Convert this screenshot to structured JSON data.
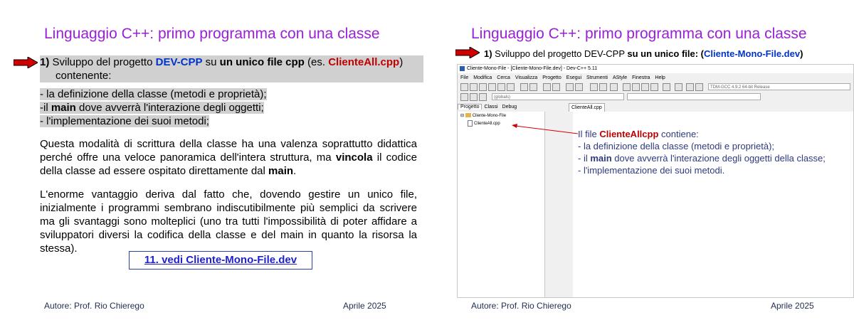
{
  "left": {
    "title": "Linguaggio C++: primo programma con una classe",
    "point1": {
      "num": "1)",
      "pre": " Sviluppo del progetto ",
      "devcpp": "DEV-CPP",
      "mid": " su ",
      "bold": "un unico file cpp",
      "es": "  (es. ",
      "file": "ClienteAll.cpp",
      "close": ")",
      "cont": "contenente:"
    },
    "defs": [
      "- la definizione della classe (metodi e proprietà);",
      [
        "-il ",
        "main",
        " dove avverrà l'interazione degli oggetti;"
      ],
      "- l'implementazione dei suoi metodi;"
    ],
    "para1": [
      "Questa modalità di scrittura della classe ha una valenza soprattutto didattica perché offre una veloce panoramica dell'intera struttura, ma ",
      "vincola",
      " il codice della classe ad essere ospitato direttamente dal ",
      "main",
      "."
    ],
    "para2": "L'enorme vantaggio deriva dal fatto che, dovendo gestire un unico file, inizialmente i programmi sembrano indiscutibilmente più semplici da scrivere ma gli svantaggi sono molteplici (uno tra tutti l'impossibilità di poter affidare a sviluppatori diversi la codifica della classe e del main in quanto la risorsa  la stessa).",
    "link": "11. vedi Cliente-Mono-File.dev",
    "author": "Autore: Prof. Rio Chierego",
    "date": "Aprile 2025"
  },
  "right": {
    "title": "Linguaggio C++: primo programma con una classe",
    "point1": {
      "num": "1)",
      "pre": " Sviluppo del progetto DEV-CPP ",
      "bold": "su un unico file: (",
      "file": "Cliente-Mono-File.dev",
      "close": ")"
    },
    "ide": {
      "window_title": "Cliente-Mono-File - [Cliente-Mono-File.dev] - Dev-C++ 5.11",
      "menu": [
        "File",
        "Modifica",
        "Cerca",
        "Visualizza",
        "Progetto",
        "Esegui",
        "Strumenti",
        "AStyle",
        "Finestra",
        "Help"
      ],
      "compiler": "TDM-GCC 4.9.2 64-bit Release",
      "scope": "(globals)",
      "panel_tabs": [
        "Progetto",
        "Classi",
        "Debug"
      ],
      "project": "Cliente-Mono-File",
      "file": "ClienteAll.cpp",
      "editor_tab": "ClienteAll.cpp"
    },
    "contains": {
      "pre": "Il file ",
      "file": "ClienteAllcpp",
      "post": " contiene:",
      "l1": "- la definizione della classe (metodi e proprietà);",
      "l2": [
        "- il ",
        "main",
        " dove avverrà l'interazione degli oggetti della classe;"
      ],
      "l3": "- l'implementazione dei suoi metodi."
    },
    "author": "Autore: Prof. Rio Chierego",
    "date": "Aprile 2025"
  },
  "colors": {
    "title": "#9a1fd6",
    "arrow": "#d00000",
    "accent_red": "#c00000",
    "accent_blue": "#0033cc",
    "highlight": "#d0d0d0"
  }
}
